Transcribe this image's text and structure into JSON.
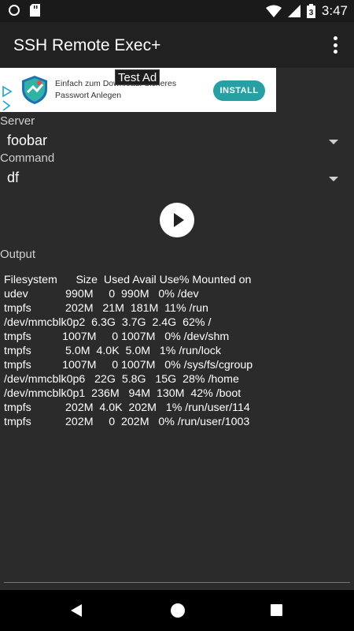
{
  "status_bar": {
    "time": "3:47",
    "battery_level": "3"
  },
  "app_bar": {
    "title": "SSH Remote Exec+"
  },
  "ad": {
    "label": "Test Ad",
    "text": "Einfach zum Download: Sicheres Passwort Anlegen",
    "install_label": "INSTALL"
  },
  "server": {
    "label": "Server",
    "value": "foobar"
  },
  "command": {
    "label": "Command",
    "value": "df"
  },
  "output": {
    "label": "Output",
    "lines": [
      "Filesystem      Size  Used Avail Use% Mounted on",
      "udev            990M     0  990M   0% /dev",
      "tmpfs           202M   21M  181M  11% /run",
      "/dev/mmcblk0p2  6.3G  3.7G  2.4G  62% /",
      "tmpfs          1007M     0 1007M   0% /dev/shm",
      "tmpfs           5.0M  4.0K  5.0M   1% /run/lock",
      "tmpfs          1007M     0 1007M   0% /sys/fs/cgroup",
      "/dev/mmcblk0p6   22G  5.8G   15G  28% /home",
      "/dev/mmcblk0p1  236M   94M  130M  42% /boot",
      "tmpfs           202M  4.0K  202M   1% /run/user/114",
      "tmpfs           202M     0  202M   0% /run/user/1003"
    ]
  },
  "colors": {
    "accent": "#27a0a4",
    "background": "#2b2b2b",
    "appbar": "#212121"
  }
}
